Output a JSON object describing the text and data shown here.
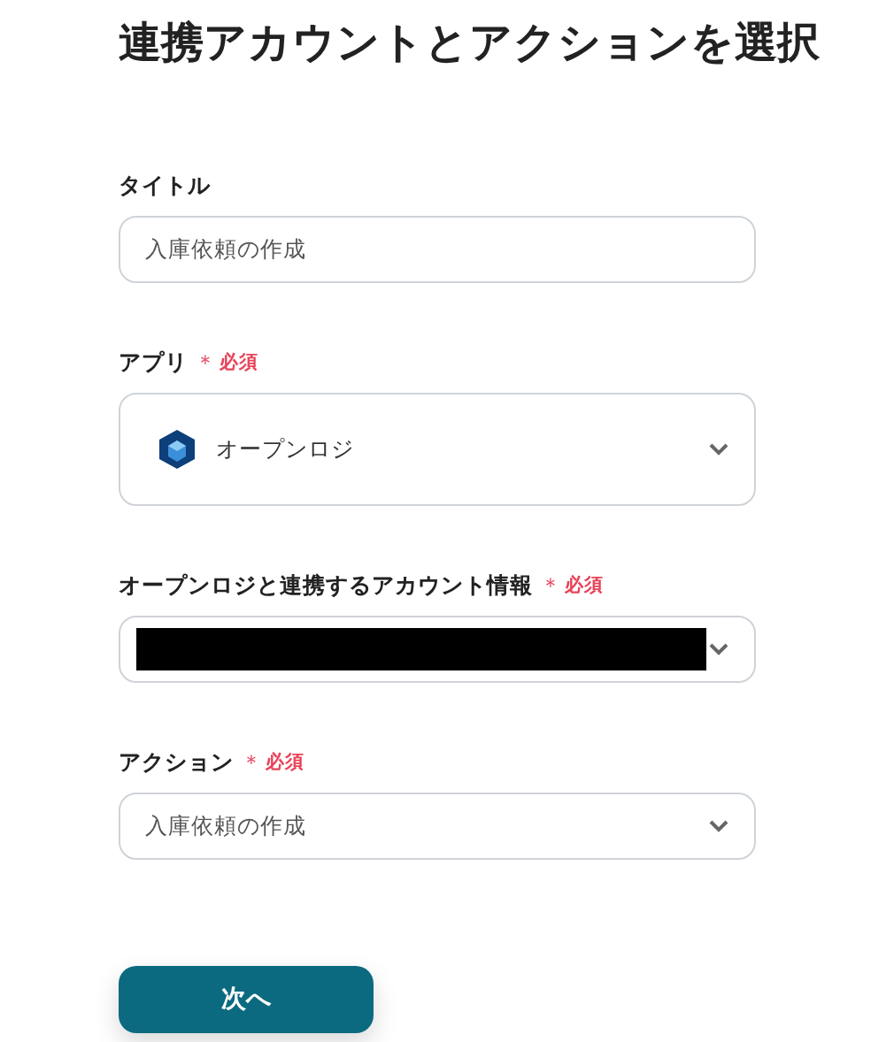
{
  "heading": "連携アカウントとアクションを選択",
  "fields": [
    {
      "kind": "text",
      "label": "タイトル",
      "value": "入庫依頼の作成"
    },
    {
      "kind": "app",
      "label": "アプリ",
      "mark": "＊",
      "required_text": "必須",
      "value": "オープンロジ"
    },
    {
      "kind": "redacted",
      "label": "オープンロジと連携するアカウント情報",
      "mark": "＊",
      "required_text": "必須"
    },
    {
      "kind": "select",
      "label": "アクション",
      "mark": "＊",
      "required_text": "必須",
      "value": "入庫依頼の作成"
    }
  ],
  "next_button": "次へ"
}
